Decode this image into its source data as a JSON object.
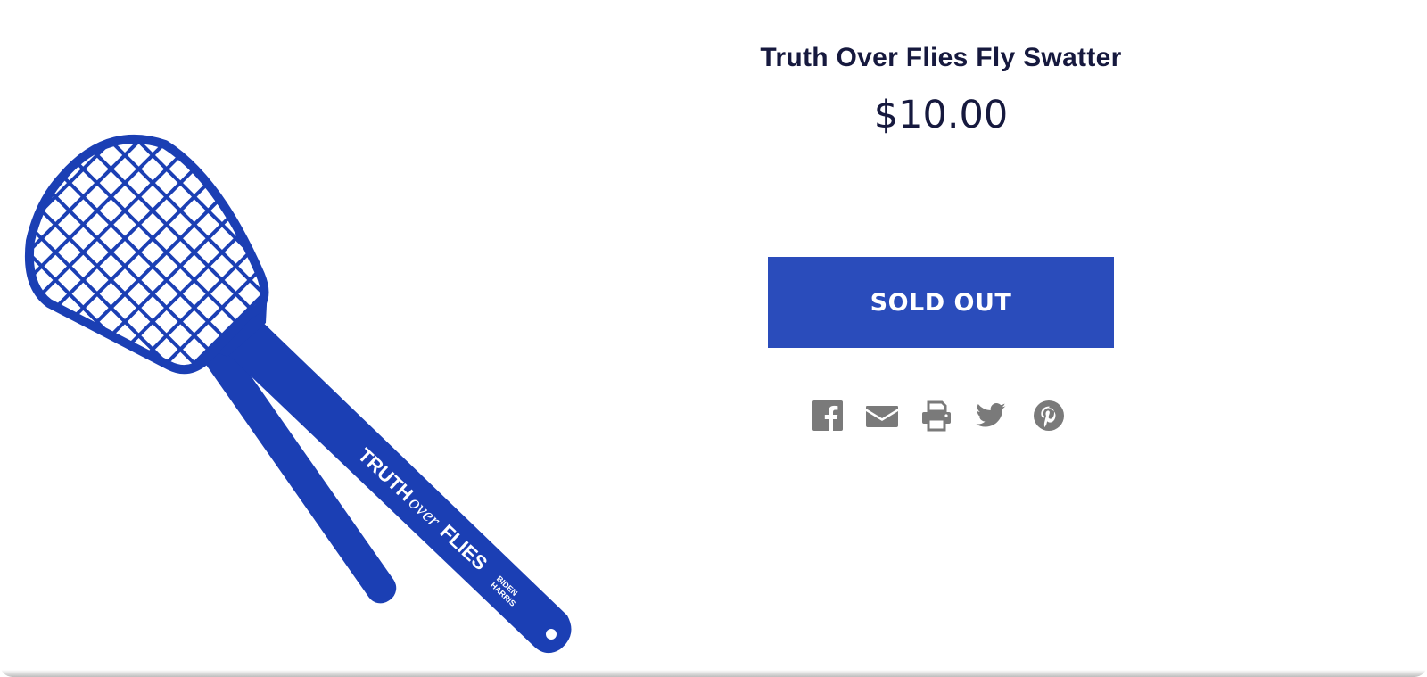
{
  "product": {
    "title": "Truth Over Flies Fly Swatter",
    "price": "$10.00",
    "button_label": "SOLD OUT",
    "image": {
      "handle_text_1": "TRUTH",
      "handle_text_2": "over",
      "handle_text_3": "FLIES",
      "logo_line_1": "BIDEN",
      "logo_line_2": "HARRIS",
      "color": "#1b3fb4"
    }
  },
  "share": {
    "icons": [
      "facebook-icon",
      "email-icon",
      "print-icon",
      "twitter-icon",
      "pinterest-icon"
    ],
    "color": "#7a7a7a"
  },
  "colors": {
    "title": "#16193e",
    "button": "#2a4cbb",
    "background": "#ffffff"
  }
}
